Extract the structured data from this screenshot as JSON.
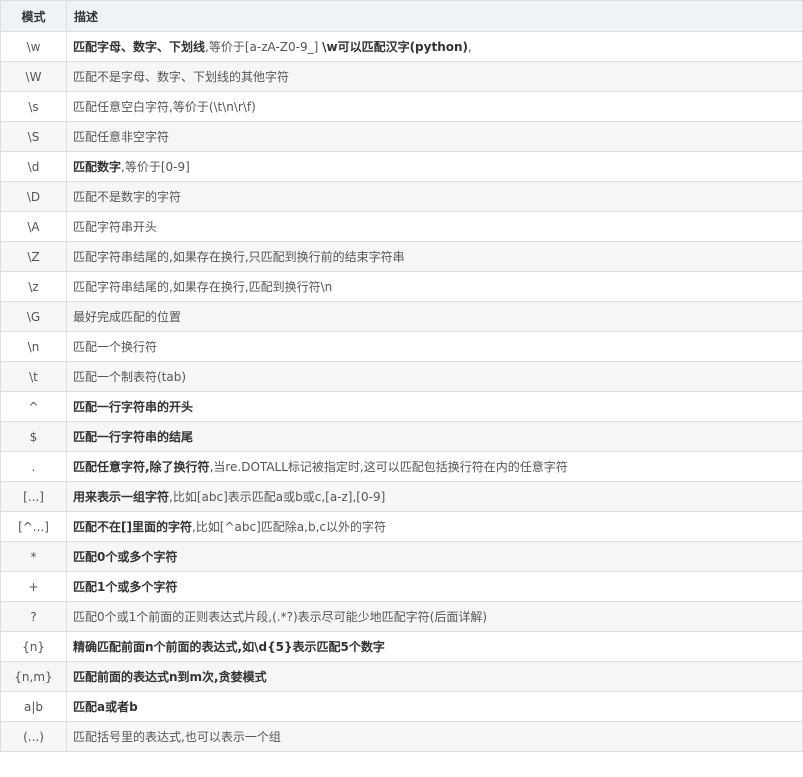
{
  "table": {
    "headers": [
      "模式",
      "描述"
    ],
    "rows": [
      {
        "pattern": "\\w",
        "desc": [
          {
            "t": "匹配字母、数字、下划线",
            "b": true
          },
          {
            "t": ",等价于[a-zA-Z0-9_] ",
            "b": false
          },
          {
            "t": "\\w可以匹配汉字(python)",
            "b": true
          },
          {
            "t": ",",
            "b": false
          }
        ]
      },
      {
        "pattern": "\\W",
        "desc": [
          {
            "t": "匹配不是字母、数字、下划线的其他字符",
            "b": false
          }
        ]
      },
      {
        "pattern": "\\s",
        "desc": [
          {
            "t": "匹配任意空白字符,等价于(\\t\\n\\r\\f)",
            "b": false
          }
        ]
      },
      {
        "pattern": "\\S",
        "desc": [
          {
            "t": "匹配任意非空字符",
            "b": false
          }
        ]
      },
      {
        "pattern": "\\d",
        "desc": [
          {
            "t": "匹配数字",
            "b": true
          },
          {
            "t": ",等价于[0-9]",
            "b": false
          }
        ]
      },
      {
        "pattern": "\\D",
        "desc": [
          {
            "t": "匹配不是数字的字符",
            "b": false
          }
        ]
      },
      {
        "pattern": "\\A",
        "desc": [
          {
            "t": "匹配字符串开头",
            "b": false
          }
        ]
      },
      {
        "pattern": "\\Z",
        "desc": [
          {
            "t": "匹配字符串结尾的,如果存在换行,只匹配到换行前的结束字符串",
            "b": false
          }
        ]
      },
      {
        "pattern": "\\z",
        "desc": [
          {
            "t": "匹配字符串结尾的,如果存在换行,匹配到换行符\\n",
            "b": false
          }
        ]
      },
      {
        "pattern": "\\G",
        "desc": [
          {
            "t": "最好完成匹配的位置",
            "b": false
          }
        ]
      },
      {
        "pattern": "\\n",
        "desc": [
          {
            "t": "匹配一个换行符",
            "b": false
          }
        ]
      },
      {
        "pattern": "\\t",
        "desc": [
          {
            "t": "匹配一个制表符(tab)",
            "b": false
          }
        ]
      },
      {
        "pattern": "^",
        "desc": [
          {
            "t": "匹配一行字符串的开头",
            "b": true
          }
        ]
      },
      {
        "pattern": "$",
        "desc": [
          {
            "t": "匹配一行字符串的结尾",
            "b": true
          }
        ]
      },
      {
        "pattern": ".",
        "desc": [
          {
            "t": "匹配任意字符,除了换行符",
            "b": true
          },
          {
            "t": ",当re.DOTALL标记被指定时,这可以匹配包括换行符在内的任意字符",
            "b": false
          }
        ]
      },
      {
        "pattern": "[...]",
        "desc": [
          {
            "t": "用来表示一组字符",
            "b": true
          },
          {
            "t": ",比如[abc]表示匹配a或b或c,[a-z],[0-9]",
            "b": false
          }
        ]
      },
      {
        "pattern": "[^...]",
        "desc": [
          {
            "t": "匹配不在[]里面的字符",
            "b": true
          },
          {
            "t": ",比如[^abc]匹配除a,b,c以外的字符",
            "b": false
          }
        ]
      },
      {
        "pattern": "*",
        "desc": [
          {
            "t": "匹配0个或多个字符",
            "b": true
          }
        ]
      },
      {
        "pattern": "+",
        "desc": [
          {
            "t": "匹配1个或多个字符",
            "b": true
          }
        ]
      },
      {
        "pattern": "?",
        "desc": [
          {
            "t": "匹配0个或1个前面的正则表达式片段,(.*?)表示尽可能少地匹配字符(后面详解)",
            "b": false
          }
        ]
      },
      {
        "pattern": "{n}",
        "desc": [
          {
            "t": "精确匹配前面n个前面的表达式,如\\d{5}表示匹配5个数字",
            "b": true
          }
        ]
      },
      {
        "pattern": "{n,m}",
        "desc": [
          {
            "t": "匹配前面的表达式n到m次,贪婪模式",
            "b": true
          }
        ]
      },
      {
        "pattern": "a|b",
        "desc": [
          {
            "t": "匹配a或者b",
            "b": true
          }
        ]
      },
      {
        "pattern": "(...)",
        "desc": [
          {
            "t": "匹配括号里的表达式,也可以表示一个组",
            "b": false
          }
        ]
      }
    ]
  }
}
